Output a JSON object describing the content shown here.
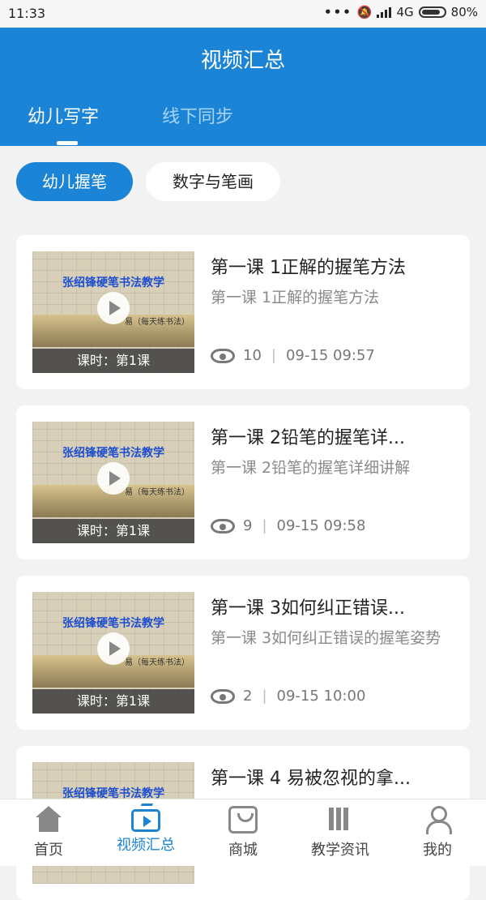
{
  "status": {
    "time": "11:33",
    "network": "4G",
    "battery": "80%"
  },
  "header": {
    "title": "视频汇总",
    "tabs": [
      "幼儿写字",
      "线下同步"
    ]
  },
  "chips": [
    "幼儿握笔",
    "数字与笔画"
  ],
  "videos": [
    {
      "title": "第一课 1正解的握笔方法",
      "subtitle": "第一课 1正解的握笔方法",
      "views": "10",
      "time": "09-15 09:57",
      "lesson": "课时：第1课",
      "brand": "张绍锋硬笔书法教学",
      "sub": "易（每天练书法）"
    },
    {
      "title": "第一课 2铅笔的握笔详...",
      "subtitle": "第一课 2铅笔的握笔详细讲解",
      "views": "9",
      "time": "09-15 09:58",
      "lesson": "课时：第1课",
      "brand": "张绍锋硬笔书法教学",
      "sub": "易（每天练书法）"
    },
    {
      "title": "第一课 3如何纠正错误...",
      "subtitle": "第一课 3如何纠正错误的握笔姿势",
      "views": "2",
      "time": "09-15 10:00",
      "lesson": "课时：第1课",
      "brand": "张绍锋硬笔书法教学",
      "sub": "易（每天练书法）"
    },
    {
      "title": "第一课 4 易被忽视的拿...",
      "subtitle": "",
      "views": "",
      "time": "",
      "lesson": "",
      "brand": "张绍锋硬笔书法教学",
      "sub": ""
    }
  ],
  "nav": [
    "首页",
    "视频汇总",
    "商城",
    "教学资讯",
    "我的"
  ],
  "colors": {
    "primary": "#1b84d6"
  },
  "icons": [
    "home-icon",
    "video-tv-icon",
    "shopping-bag-icon",
    "books-icon",
    "user-icon"
  ]
}
